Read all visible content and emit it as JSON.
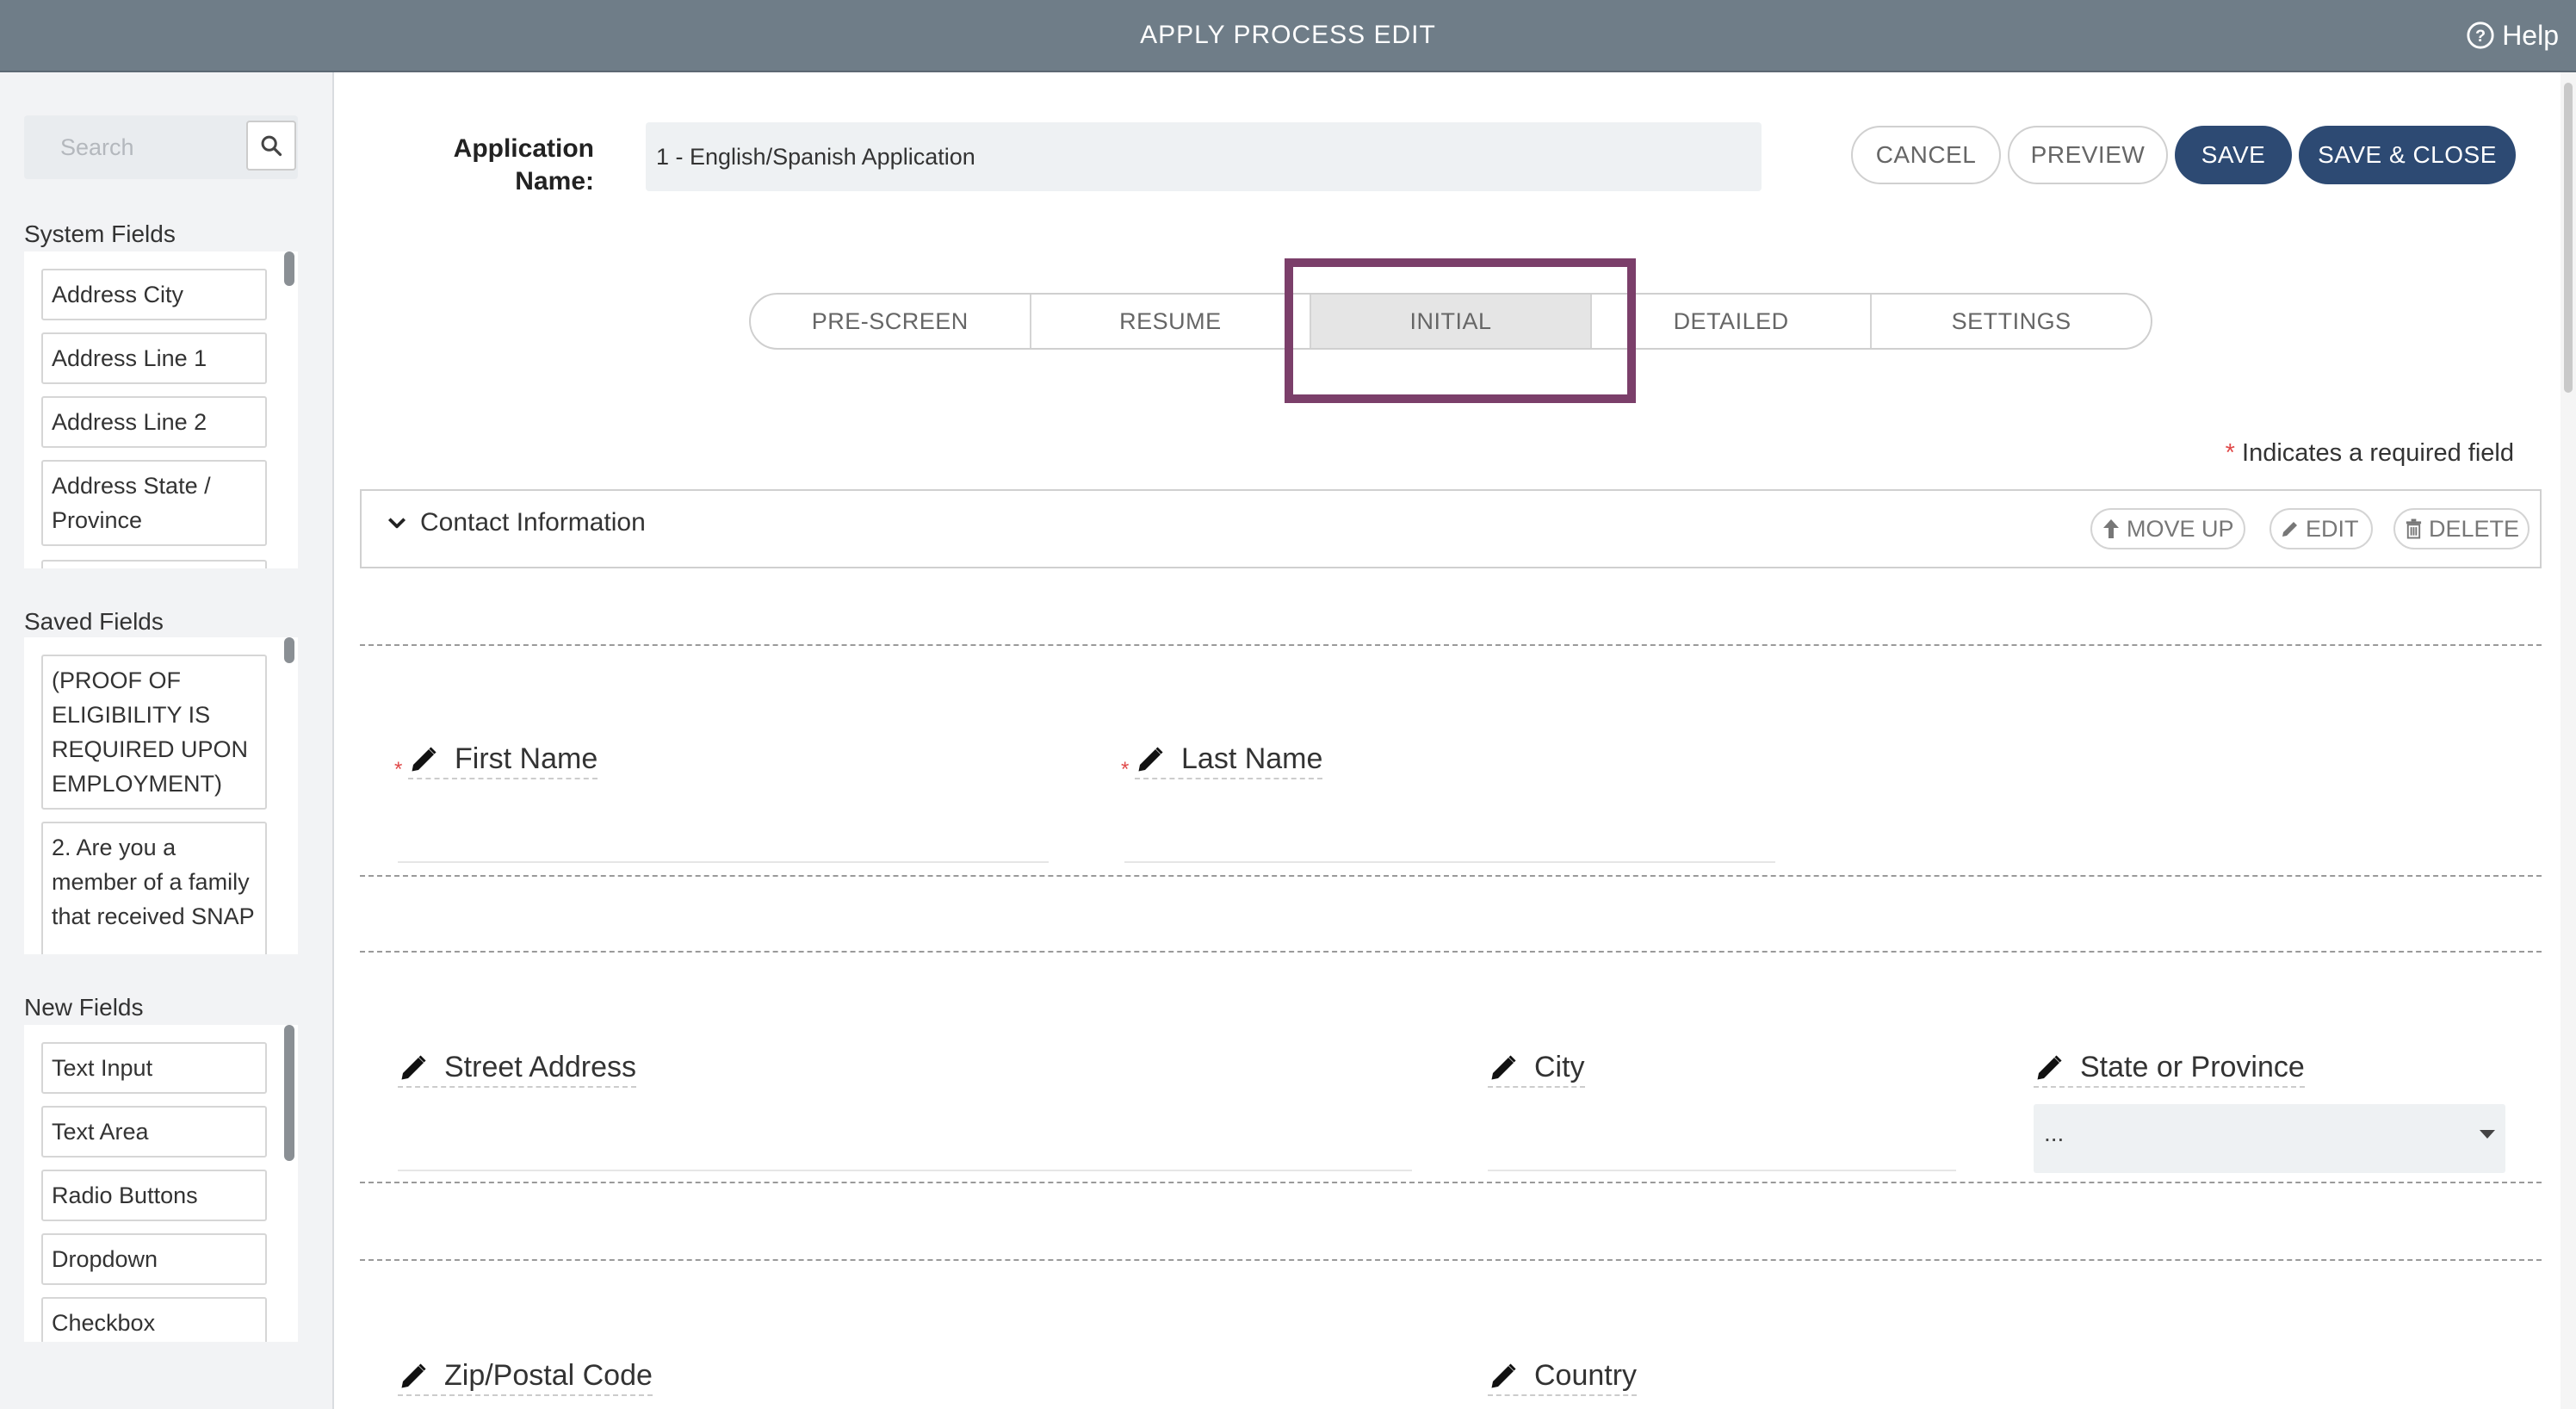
{
  "header": {
    "title": "APPLY PROCESS EDIT",
    "help": "Help"
  },
  "sidebar": {
    "search_placeholder": "Search",
    "system_fields": {
      "title": "System Fields",
      "items": [
        "Address City",
        "Address Line 1",
        "Address Line 2",
        "Address State / Province"
      ]
    },
    "saved_fields": {
      "title": "Saved Fields",
      "items": [
        "(PROOF OF ELIGIBILITY IS REQUIRED UPON EMPLOYMENT)",
        "2. Are you a member of a family that received SNAP"
      ]
    },
    "new_fields": {
      "title": "New Fields",
      "items": [
        "Text Input",
        "Text Area",
        "Radio Buttons",
        "Dropdown",
        "Checkbox"
      ]
    }
  },
  "main": {
    "app_name_label": "Application Name:",
    "app_name_value": "1 - English/Spanish Application",
    "buttons": {
      "cancel": "CANCEL",
      "preview": "PREVIEW",
      "save": "SAVE",
      "save_close": "SAVE & CLOSE"
    },
    "tabs": [
      {
        "label": "PRE-SCREEN",
        "active": false
      },
      {
        "label": "RESUME",
        "active": false
      },
      {
        "label": "INITIAL",
        "active": true
      },
      {
        "label": "DETAILED",
        "active": false
      },
      {
        "label": "SETTINGS",
        "active": false
      }
    ],
    "required_note": {
      "star": "*",
      "text": "Indicates a required field"
    },
    "section": {
      "title": "Contact Information",
      "move_up": "MOVE UP",
      "edit": "EDIT",
      "delete": "DELETE"
    },
    "fields": {
      "first_name": "First Name",
      "last_name": "Last Name",
      "street_address": "Street Address",
      "city": "City",
      "state": "State or Province",
      "state_value": "...",
      "zip": "Zip/Postal Code",
      "country": "Country"
    }
  },
  "colors": {
    "header_bg": "#6f7d88",
    "primary": "#2d4a73",
    "highlight": "#7b3f6a",
    "required": "#e04a4a"
  }
}
